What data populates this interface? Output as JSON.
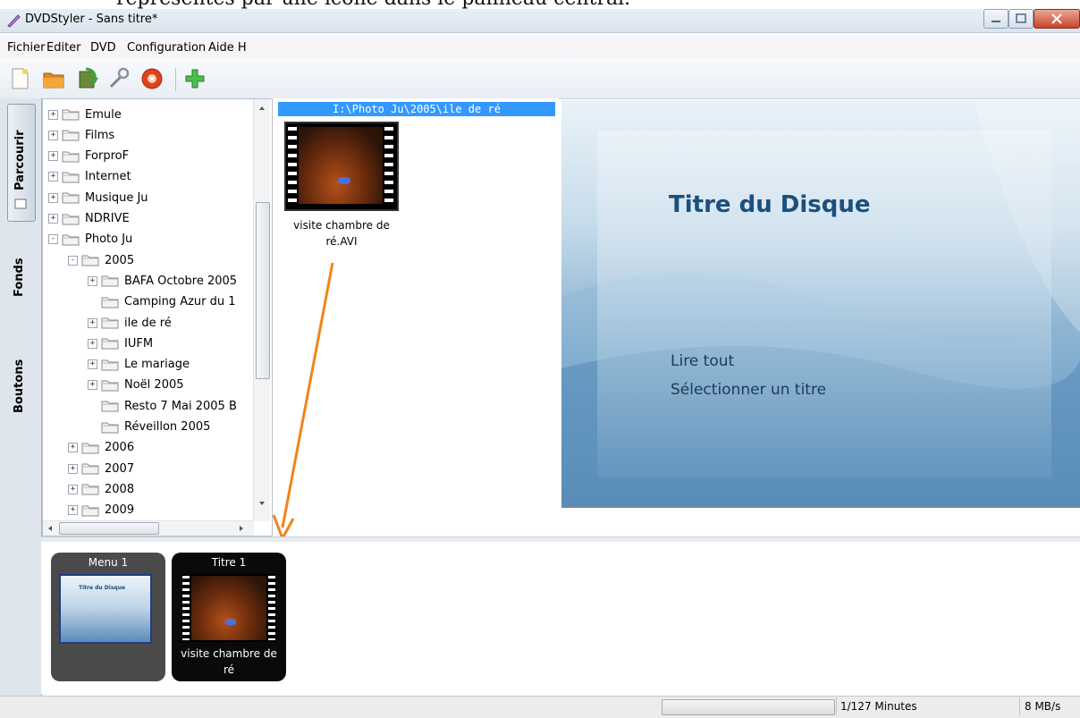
{
  "document_caption": "représentés par une icône dans le panneau central.",
  "window": {
    "title": "DVDStyler - Sans titre*"
  },
  "menubar": {
    "items": [
      "Fichier",
      "Editer",
      "DVD",
      "Configuration",
      "Aide H"
    ]
  },
  "toolbar": {
    "buttons": [
      "new-icon",
      "open-icon",
      "save-icon",
      "settings-icon",
      "burn-icon",
      "add-icon"
    ]
  },
  "left_tabs": [
    "Parcourir",
    "Fonds",
    "Boutons"
  ],
  "tree": {
    "items": [
      {
        "label": "Emule",
        "level": 0,
        "expander": "+"
      },
      {
        "label": "Films",
        "level": 0,
        "expander": "+"
      },
      {
        "label": "ForproF",
        "level": 0,
        "expander": "+"
      },
      {
        "label": "Internet",
        "level": 0,
        "expander": "+"
      },
      {
        "label": "Musique Ju",
        "level": 0,
        "expander": "+"
      },
      {
        "label": "NDRIVE",
        "level": 0,
        "expander": "+"
      },
      {
        "label": "Photo Ju",
        "level": 0,
        "expander": "-"
      },
      {
        "label": "2005",
        "level": 1,
        "expander": "-"
      },
      {
        "label": "BAFA Octobre 2005",
        "level": 2,
        "expander": "+"
      },
      {
        "label": "Camping Azur du 1",
        "level": 2,
        "expander": ""
      },
      {
        "label": "ile de ré",
        "level": 2,
        "expander": "+"
      },
      {
        "label": "IUFM",
        "level": 2,
        "expander": "+"
      },
      {
        "label": "Le mariage",
        "level": 2,
        "expander": "+"
      },
      {
        "label": "Noël 2005",
        "level": 2,
        "expander": "+"
      },
      {
        "label": "Resto 7 Mai 2005 B",
        "level": 2,
        "expander": ""
      },
      {
        "label": "Réveillon 2005",
        "level": 2,
        "expander": ""
      },
      {
        "label": "2006",
        "level": 1,
        "expander": "+"
      },
      {
        "label": "2007",
        "level": 1,
        "expander": "+"
      },
      {
        "label": "2008",
        "level": 1,
        "expander": "+"
      },
      {
        "label": "2009",
        "level": 1,
        "expander": "+"
      }
    ]
  },
  "file_browser": {
    "path": "I:\\Photo Ju\\2005\\ile de ré",
    "file_name_line1": "visite chambre de",
    "file_name_line2": "ré.AVI"
  },
  "menu_editor": {
    "disc_title": "Titre du Disque",
    "buttons": [
      "Lire tout",
      "Sélectionner un titre"
    ]
  },
  "titleset": {
    "menu_card_label": "Menu 1",
    "menu_thumb_title": "Titre du Disque",
    "title_card_label": "Titre 1",
    "title_card_name_line1": "visite chambre de",
    "title_card_name_line2": "ré"
  },
  "status": {
    "minutes": "1/127 Minutes",
    "speed": "8 MB/s"
  },
  "colors": {
    "selection": "#3399ff",
    "arrow": "#f0841c",
    "disc_title": "#1b4f7e"
  }
}
